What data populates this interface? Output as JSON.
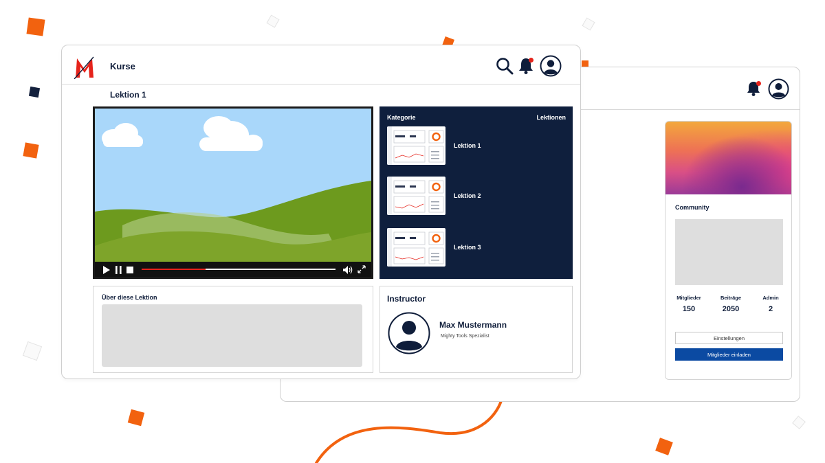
{
  "front": {
    "nav_title": "Kurse",
    "lesson_title": "Lektion 1",
    "video": {
      "progress": 0.33
    },
    "category_panel": {
      "left_header": "Kategorie",
      "right_header": "Lektionen",
      "lessons": [
        {
          "label": "Lektion 1"
        },
        {
          "label": "Lektion 2"
        },
        {
          "label": "Lektion 3"
        }
      ]
    },
    "about": {
      "title": "Über diese Lektion"
    },
    "instructor": {
      "title": "Instructor",
      "name": "Max Mustermann",
      "role": "Mighty Tools Spezialist"
    },
    "icons": [
      "logo-icon",
      "search-icon",
      "bell-icon",
      "user-avatar-icon"
    ]
  },
  "back": {
    "community": {
      "title": "Community",
      "stats": [
        {
          "label": "Mitglieder",
          "value": "150"
        },
        {
          "label": "Beiträge",
          "value": "2050"
        },
        {
          "label": "Admin",
          "value": "2"
        }
      ],
      "settings_button": "Einstellungen",
      "invite_button": "Mitglieder einladen"
    }
  },
  "colors": {
    "accent_orange": "#f2620f",
    "navy": "#0f1f3d",
    "primary_blue": "#0b4aa2",
    "notification_red": "#e5231b"
  }
}
